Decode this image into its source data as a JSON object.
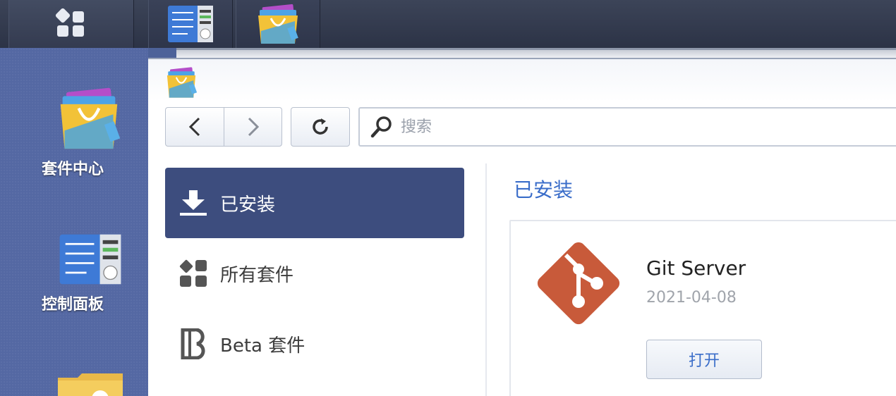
{
  "taskbar": {
    "buttons": [
      {
        "name": "main-menu",
        "icon": "grid-menu-icon"
      },
      {
        "name": "control-panel",
        "icon": "control-panel-icon"
      },
      {
        "name": "package-center",
        "icon": "package-center-icon"
      }
    ]
  },
  "desktop": {
    "icons": [
      {
        "label": "套件中心",
        "icon": "package-center-icon"
      },
      {
        "label": "控制面板",
        "icon": "control-panel-icon"
      },
      {
        "label": "",
        "icon": "folder-icon"
      }
    ]
  },
  "window": {
    "search": {
      "placeholder": "搜索"
    },
    "sidebar": {
      "items": [
        {
          "label": "已安装",
          "icon": "download-icon",
          "active": true
        },
        {
          "label": "所有套件",
          "icon": "grid-icon",
          "active": false
        },
        {
          "label": "Beta 套件",
          "icon": "beta-icon",
          "active": false
        }
      ]
    },
    "main": {
      "section_title": "已安装",
      "packages": [
        {
          "name": "Git Server",
          "date": "2021-04-08",
          "button_label": "打开",
          "icon": "git-icon"
        }
      ]
    }
  },
  "colors": {
    "accent": "#3a6dc9",
    "sidebar_active": "#3d4d7e",
    "git_brand": "#c85a3a"
  }
}
